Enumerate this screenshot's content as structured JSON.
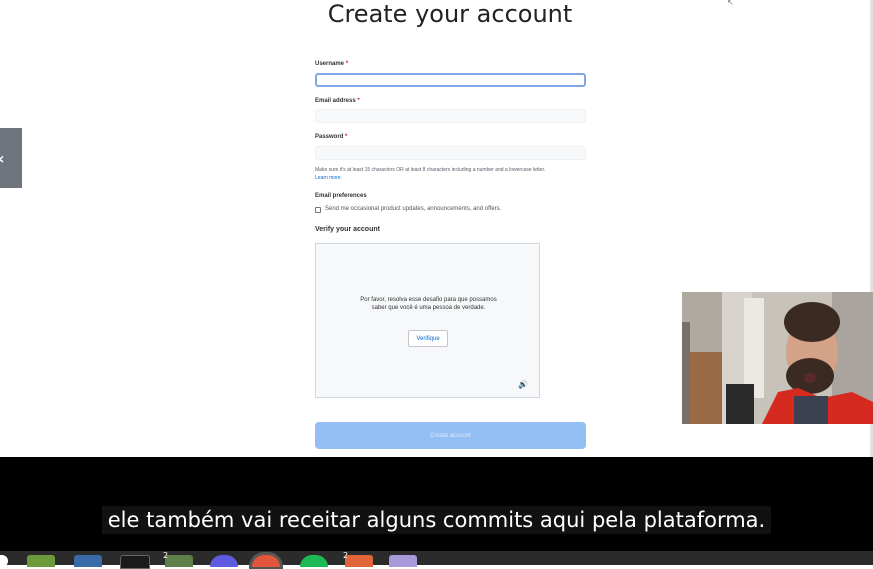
{
  "page": {
    "title": "Create your account",
    "back_glyph": "‹"
  },
  "form": {
    "username_label": "Username",
    "email_label": "Email address",
    "password_label": "Password",
    "required_mark": "*",
    "password_hint": "Make sure it's at least 15 characters OR at least 8 characters including a number and a lowercase letter.",
    "learn_more": "Learn more.",
    "email_prefs_label": "Email preferences",
    "email_prefs_option": "Send me occasional product updates, announcements, and offers.",
    "verify_heading": "Verify your account",
    "captcha_message": "Por favor, resolva esse desafio para que possamos saber que você é uma pessoa de verdade.",
    "verify_button": "Verifique",
    "create_button": "Create account"
  },
  "caption": {
    "text": "ele também vai receitar alguns commits aqui pela plataforma."
  },
  "taskbar": {
    "badges": [
      "2",
      "2"
    ]
  },
  "icons": {
    "back": "chevron-left-icon",
    "audio": "speaker-icon"
  }
}
